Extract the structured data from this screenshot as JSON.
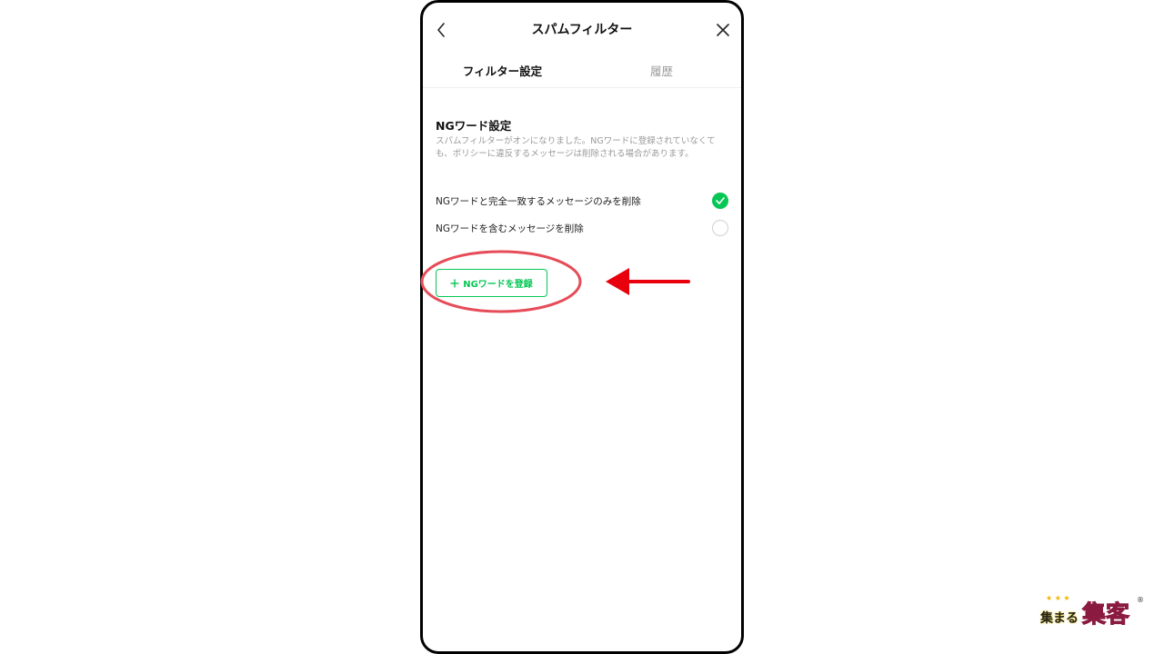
{
  "header": {
    "title": "スパムフィルター"
  },
  "tabs": [
    {
      "label": "フィルター設定",
      "active": true
    },
    {
      "label": "履歴",
      "active": false
    }
  ],
  "section": {
    "title": "NGワード設定",
    "description": "スパムフィルターがオンになりました。NGワードに登録されていなくても、ポリシーに違反するメッセージは削除される場合があります。"
  },
  "options": [
    {
      "label": "NGワードと完全一致するメッセージのみを削除",
      "selected": true
    },
    {
      "label": "NGワードを含むメッセージを削除",
      "selected": false
    }
  ],
  "add_button": {
    "label": "NGワードを登録"
  },
  "logo": {
    "text_small": "集まる",
    "text_large": "集客"
  },
  "colors": {
    "accent": "#06c755",
    "annotation": "#e64c58",
    "arrow": "#e8000c"
  }
}
